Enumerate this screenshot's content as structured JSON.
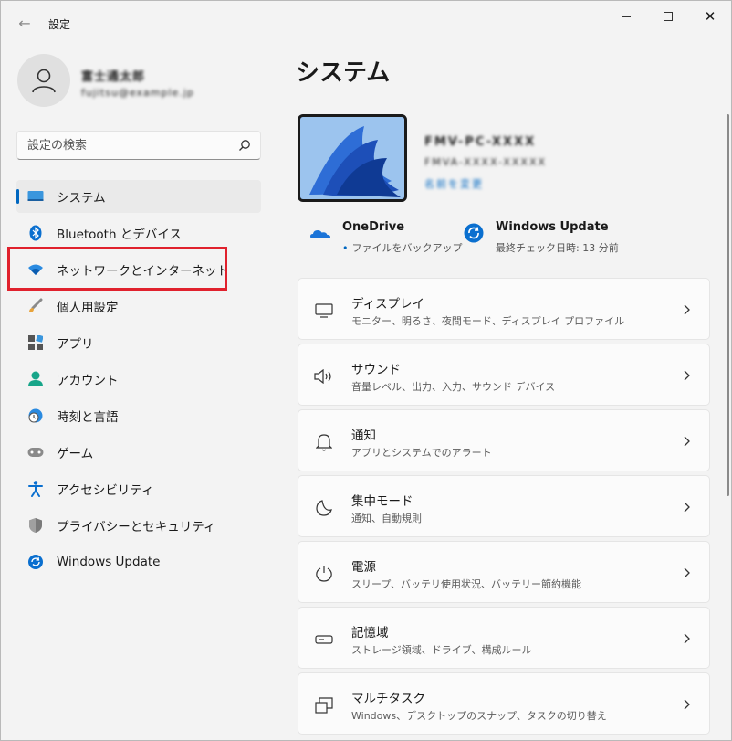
{
  "app": {
    "title": "設定",
    "back_glyph": "←"
  },
  "window": {
    "minimize_label": "",
    "maximize_label": "",
    "close_glyph": "✕"
  },
  "user": {
    "name": "富士通太郎",
    "email": "fujitsu@example.jp"
  },
  "search": {
    "placeholder": "設定の検索"
  },
  "sidebar": {
    "items": [
      {
        "label": "システム",
        "icon": "system-icon",
        "selected": true
      },
      {
        "label": "Bluetooth とデバイス",
        "icon": "bluetooth-icon"
      },
      {
        "label": "ネットワークとインターネット",
        "icon": "wifi-icon",
        "highlighted": true
      },
      {
        "label": "個人用設定",
        "icon": "brush-icon"
      },
      {
        "label": "アプリ",
        "icon": "apps-icon"
      },
      {
        "label": "アカウント",
        "icon": "account-icon"
      },
      {
        "label": "時刻と言語",
        "icon": "time-language-icon"
      },
      {
        "label": "ゲーム",
        "icon": "gamepad-icon"
      },
      {
        "label": "アクセシビリティ",
        "icon": "accessibility-icon"
      },
      {
        "label": "プライバシーとセキュリティ",
        "icon": "shield-icon"
      },
      {
        "label": "Windows Update",
        "icon": "update-icon"
      }
    ]
  },
  "main": {
    "title": "システム",
    "device": {
      "name": "FMV-PC-XXXX",
      "model": "FMVA-XXXX-XXXXX",
      "rename": "名前を変更"
    },
    "quick": [
      {
        "title": "OneDrive",
        "subtitle": "ファイルをバックアップ",
        "icon": "onedrive-icon"
      },
      {
        "title": "Windows Update",
        "subtitle": "最終チェック日時: 13 分前",
        "icon": "update-icon"
      }
    ],
    "cards": [
      {
        "title": "ディスプレイ",
        "subtitle": "モニター、明るさ、夜間モード、ディスプレイ プロファイル",
        "icon": "display-icon"
      },
      {
        "title": "サウンド",
        "subtitle": "音量レベル、出力、入力、サウンド デバイス",
        "icon": "speaker-icon"
      },
      {
        "title": "通知",
        "subtitle": "アプリとシステムでのアラート",
        "icon": "bell-icon"
      },
      {
        "title": "集中モード",
        "subtitle": "通知、自動規則",
        "icon": "moon-icon"
      },
      {
        "title": "電源",
        "subtitle": "スリープ、バッテリ使用状況、バッテリー節約機能",
        "icon": "power-icon"
      },
      {
        "title": "記憶域",
        "subtitle": "ストレージ領域、ドライブ、構成ルール",
        "icon": "storage-icon"
      },
      {
        "title": "マルチタスク",
        "subtitle": "Windows、デスクトップのスナップ、タスクの切り替え",
        "icon": "multitask-icon"
      }
    ]
  },
  "colors": {
    "accent": "#0067c0",
    "highlight_border": "#e0212d",
    "background": "#f3f3f3",
    "card": "#fbfbfb"
  }
}
